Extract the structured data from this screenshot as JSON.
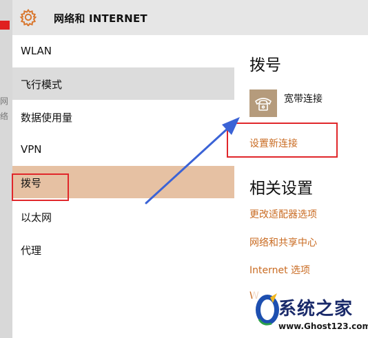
{
  "window": {
    "title": "网络和 INTERNET"
  },
  "background": {
    "chars": [
      "网",
      "络"
    ]
  },
  "sidebar": {
    "items": [
      {
        "label": "WLAN"
      },
      {
        "label": "飞行模式"
      },
      {
        "label": "数据使用量"
      },
      {
        "label": "VPN"
      },
      {
        "label": "拨号"
      },
      {
        "label": "以太网"
      },
      {
        "label": "代理"
      }
    ],
    "hovered_index": 1,
    "selected_index": 4
  },
  "main": {
    "section_title": "拨号",
    "connection": {
      "label": "宽带连接",
      "icon": "phone-icon"
    },
    "setup_link": "设置新连接",
    "related_title": "相关设置",
    "related_links": [
      "更改适配器选项",
      "网络和共享中心",
      "Internet 选项",
      "W"
    ]
  },
  "watermark": {
    "title": "系统之家",
    "url": "www.Ghost123.com"
  },
  "colors": {
    "accent": "#c96b22",
    "selected_bg": "#e6c1a3",
    "hover_bg": "#dcdcdc",
    "annotation_red": "#e0262a",
    "arrow_blue": "#3b63d6"
  }
}
